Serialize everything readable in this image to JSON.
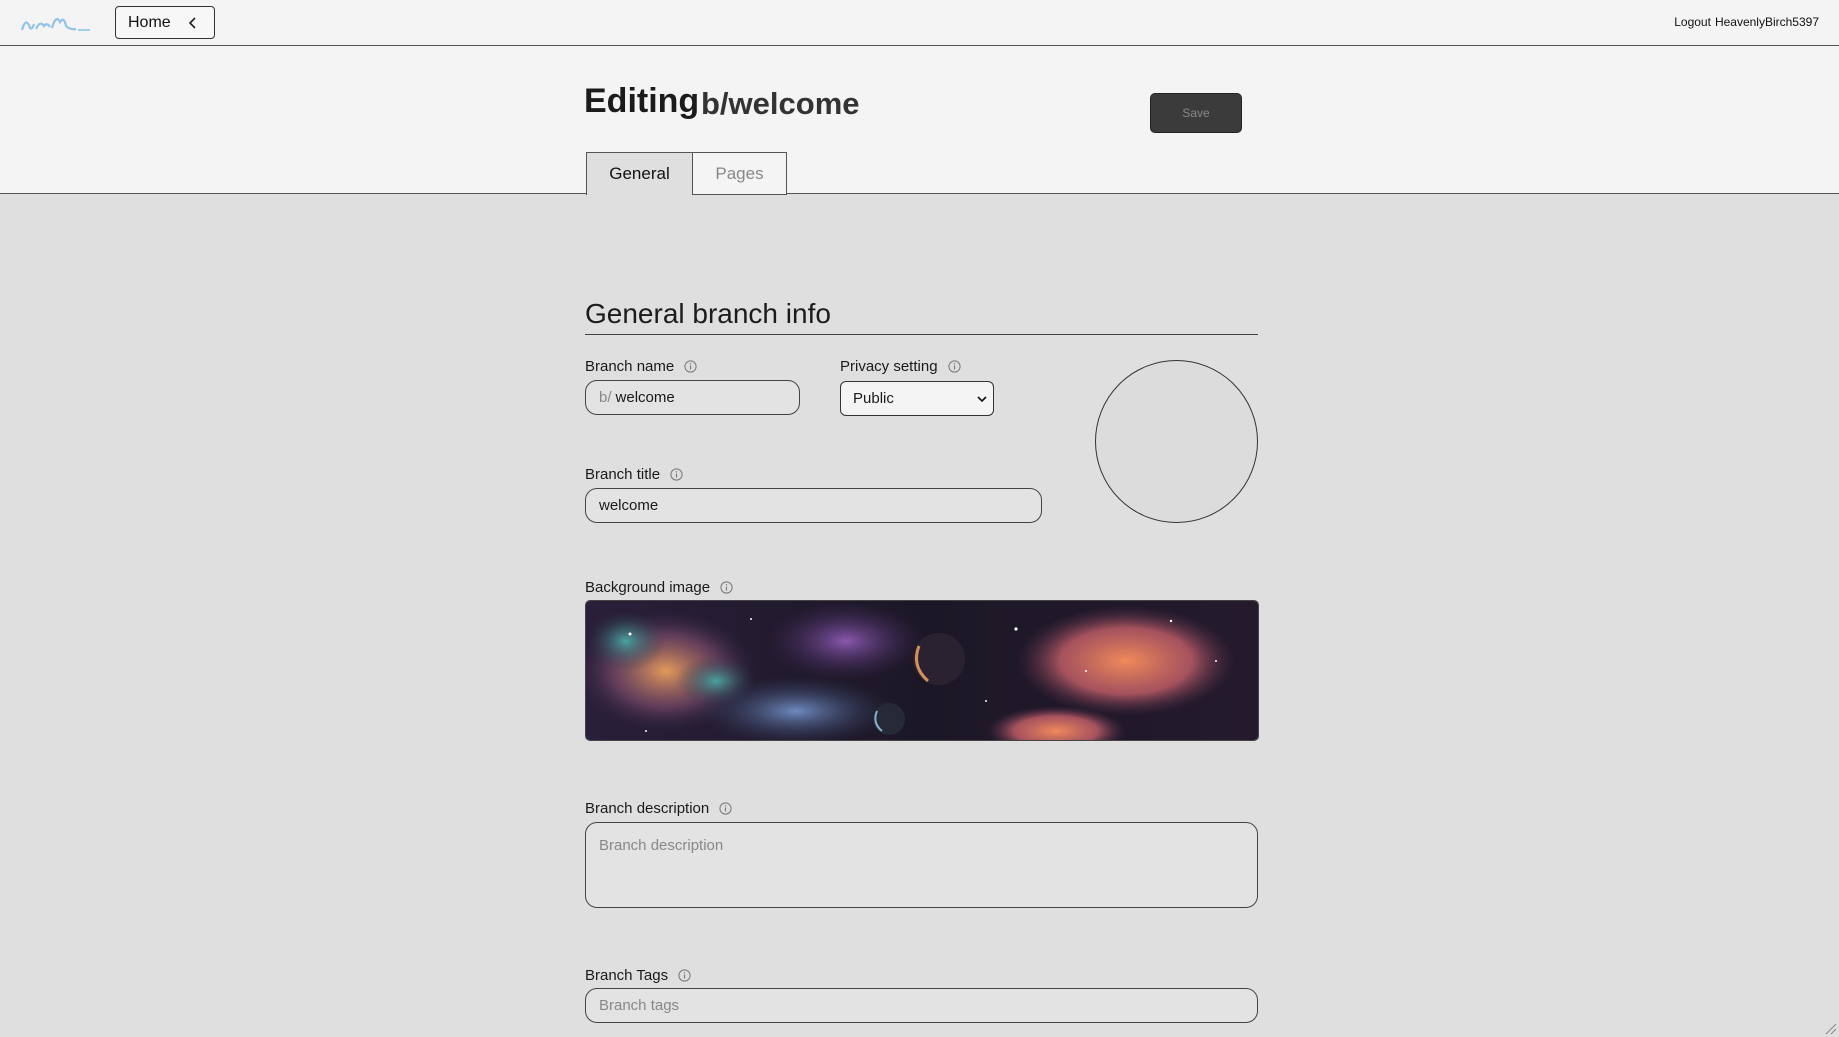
{
  "topbar": {
    "home_label": "Home",
    "logout_label": "Logout",
    "username": "HeavenlyBirch5397"
  },
  "header": {
    "editing_label": "Editing",
    "branch_path": "b/welcome",
    "save_label": "Save",
    "tabs": [
      {
        "label": "General",
        "active": true
      },
      {
        "label": "Pages",
        "active": false
      }
    ]
  },
  "form": {
    "section_title": "General branch info",
    "branch_name": {
      "label": "Branch name",
      "prefix": "b/",
      "value": "welcome"
    },
    "privacy": {
      "label": "Privacy setting",
      "selected": "Public"
    },
    "branch_title": {
      "label": "Branch title",
      "value": "welcome"
    },
    "background_image": {
      "label": "Background image"
    },
    "description": {
      "label": "Branch description",
      "placeholder": "Branch description"
    },
    "tags": {
      "label": "Branch Tags",
      "placeholder": "Branch tags"
    }
  },
  "colors": {
    "page_bg": "#dfdfdf",
    "header_bg": "#f4f4f4",
    "save_bg": "#3b3b3b",
    "logo_blue": "#8fc4e8"
  }
}
